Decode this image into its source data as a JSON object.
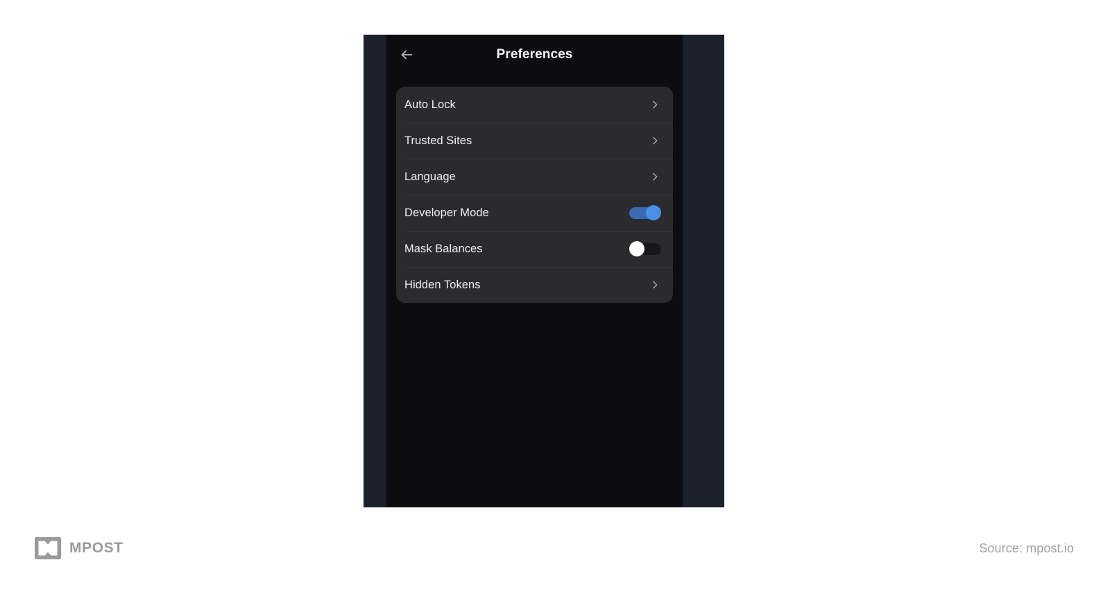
{
  "header": {
    "title": "Preferences",
    "back_icon": "arrow-left-icon"
  },
  "settings": {
    "rows": [
      {
        "label": "Auto Lock",
        "type": "navigation",
        "icon": "chevron-right-icon"
      },
      {
        "label": "Trusted Sites",
        "type": "navigation",
        "icon": "chevron-right-icon"
      },
      {
        "label": "Language",
        "type": "navigation",
        "icon": "chevron-right-icon"
      },
      {
        "label": "Developer Mode",
        "type": "toggle",
        "state": "on"
      },
      {
        "label": "Mask Balances",
        "type": "toggle",
        "state": "off"
      },
      {
        "label": "Hidden Tokens",
        "type": "navigation",
        "icon": "chevron-right-icon"
      }
    ]
  },
  "footer": {
    "logo_text": "MPOST",
    "logo_icon": "mpost-logo-icon",
    "source": "Source: mpost.io"
  },
  "colors": {
    "page_background": "#ffffff",
    "frame_navy": "#1a202c",
    "screen_background": "#0d0d10",
    "card_background": "#2b2b2e",
    "divider": "#37373a",
    "label_text": "#f0f0f2",
    "title_text": "#f2f2f5",
    "chevron": "#a8a8b0",
    "toggle_on_track": "#3b6ab0",
    "toggle_on_knob": "#4a90e8",
    "toggle_off_track": "#17171a",
    "toggle_off_knob": "#ffffff",
    "watermark": "#9a9a9a"
  }
}
